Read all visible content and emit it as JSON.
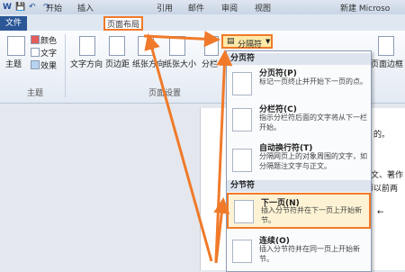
{
  "window": {
    "title": "新建 Microso"
  },
  "quick_access": {
    "word_icon": "W",
    "save_icon": "💾",
    "undo_icon": "↶",
    "redo_icon": "↷"
  },
  "tabs": [
    "文件",
    "开始",
    "插入",
    "页面布局",
    "引用",
    "邮件",
    "审阅",
    "视图"
  ],
  "ribbon": {
    "theme": {
      "label": "主题",
      "colors": "颜色",
      "fonts": "文字",
      "effects": "效果",
      "group": "主题"
    },
    "page_setup": {
      "text_direction": "文字方向",
      "margins": "页边距",
      "orientation": "纸张方向",
      "size": "纸张大小",
      "columns": "分栏",
      "group": "页面设置"
    },
    "breaks_label": "分隔符",
    "page_border": "页面边框"
  },
  "menu": {
    "page_breaks_header": "分页符",
    "section_breaks_header": "分节符",
    "items": [
      {
        "title": "分页符(P)",
        "desc": "标记一页终止并开始下一页的点。"
      },
      {
        "title": "分栏符(C)",
        "desc": "指示分栏符后面的文字将从下一栏开始。"
      },
      {
        "title": "自动换行符(T)",
        "desc": "分隔网页上的对象周围的文字，如分隔题注文字与正文。"
      },
      {
        "title": "下一页(N)",
        "desc": "插入分节符并在下一页上开始新节。"
      },
      {
        "title": "连续(O)",
        "desc": "插入分节符并在同一页上开始新节。"
      }
    ]
  },
  "document": {
    "lines": [
      "的。",
      "论文、著作",
      "师以前两",
      "←"
    ]
  },
  "colors": {
    "accent": "#f07a2a",
    "file_tab": "#2b5797"
  }
}
